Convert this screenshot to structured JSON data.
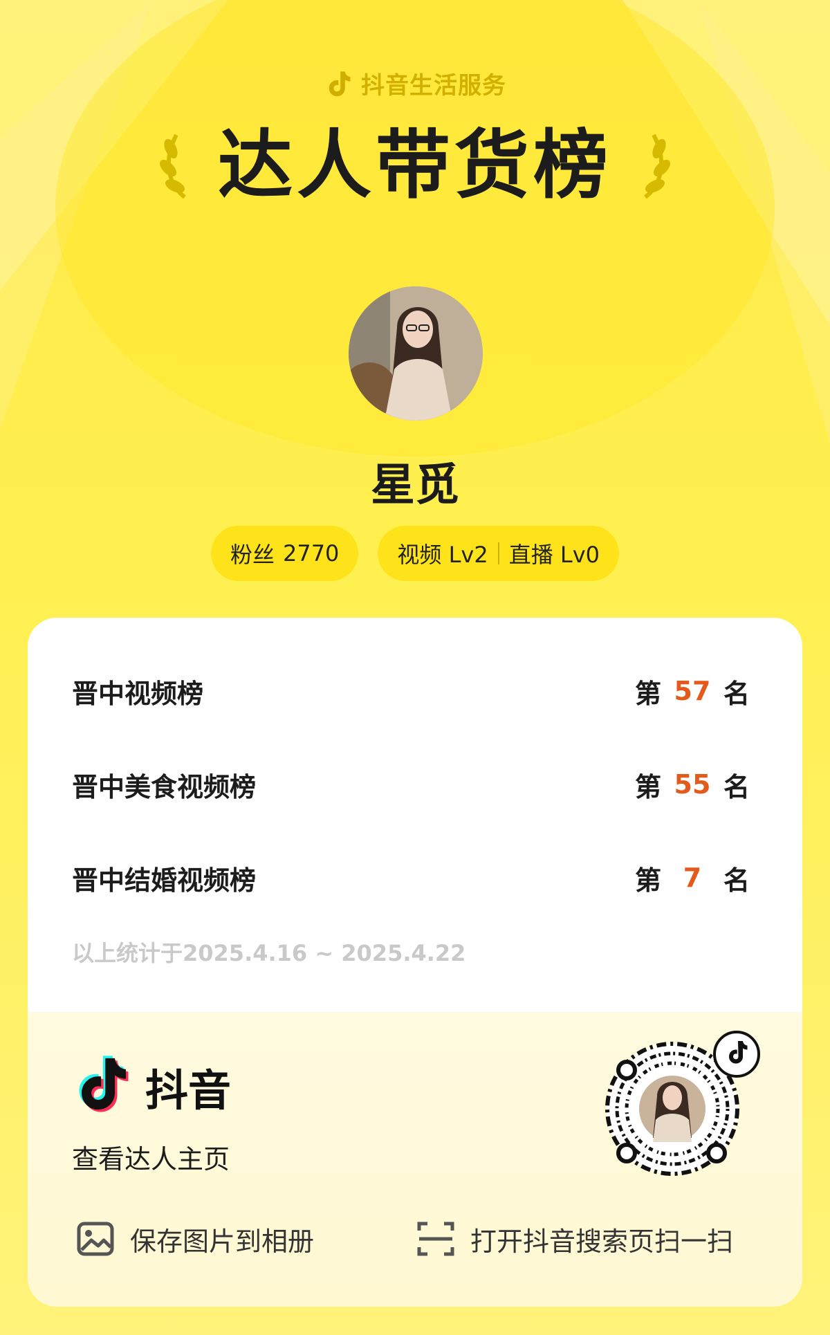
{
  "header": {
    "service_name": "抖音生活服务",
    "title": "达人带货榜"
  },
  "profile": {
    "name": "星觅",
    "fans_label": "粉丝",
    "fans_count": "2770",
    "video_level": "视频 Lv2",
    "live_level": "直播 Lv0"
  },
  "rankings": [
    {
      "list": "晋中视频榜",
      "prefix": "第",
      "rank": "57",
      "suffix": "名"
    },
    {
      "list": "晋中美食视频榜",
      "prefix": "第",
      "rank": "55",
      "suffix": "名"
    },
    {
      "list": "晋中结婚视频榜",
      "prefix": "第",
      "rank": "7",
      "suffix": "名"
    }
  ],
  "stat_period": "以上统计于2025.4.16 ~ 2025.4.22",
  "footer": {
    "brand": "抖音",
    "view_home": "查看达人主页",
    "save_image": "保存图片到相册",
    "scan_tip": "打开抖音搜索页扫一扫"
  },
  "colors": {
    "accent_yellow": "#ffe31a",
    "rank_orange": "#e35a1b",
    "douyin_cyan": "#25f4ee",
    "douyin_red": "#fe2c55"
  },
  "icons": [
    "douyin-logo-icon",
    "laurel-left-icon",
    "laurel-right-icon",
    "image-icon",
    "scan-icon",
    "qr-code"
  ]
}
